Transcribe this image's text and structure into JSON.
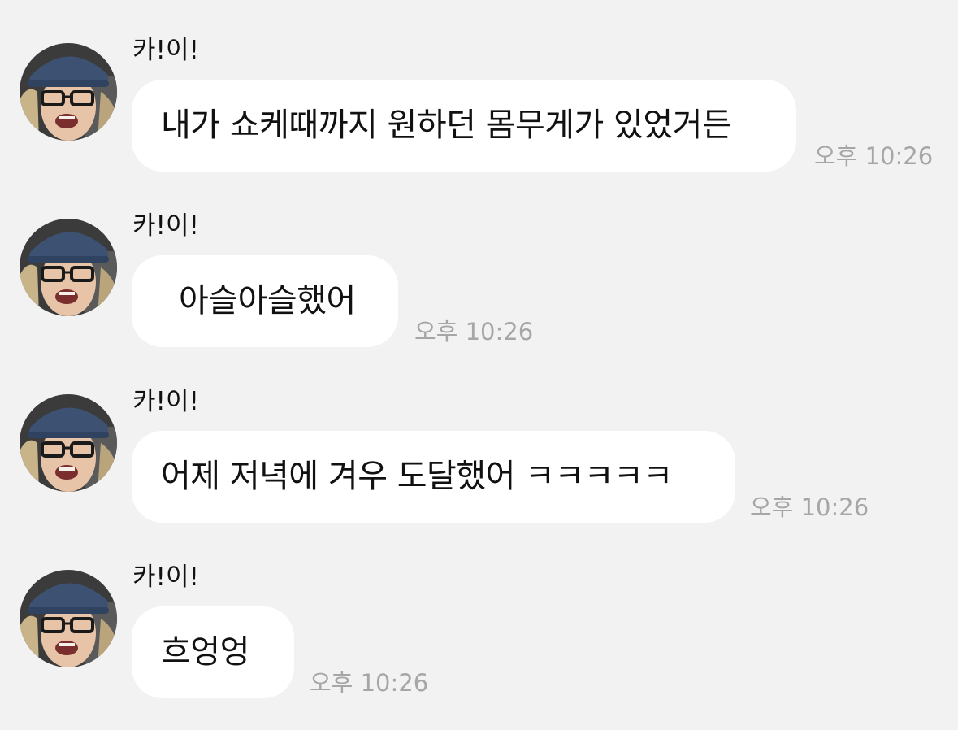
{
  "messages": [
    {
      "sender": "카!이!",
      "text": "내가 쇼케때까지 원하던 몸무게가 있었거든",
      "time": "오후 10:26"
    },
    {
      "sender": "카!이!",
      "text": "아슬아슬했어",
      "time": "오후 10:26"
    },
    {
      "sender": "카!이!",
      "text": "어제 저녁에 겨우 도달했어 ㅋㅋㅋㅋㅋ",
      "time": "오후 10:26"
    },
    {
      "sender": "카!이!",
      "text": "흐엉엉",
      "time": "오후 10:26"
    }
  ],
  "colors": {
    "background": "#f2f2f2",
    "bubble": "#ffffff",
    "text": "#111111",
    "time": "#a6a6a6"
  }
}
